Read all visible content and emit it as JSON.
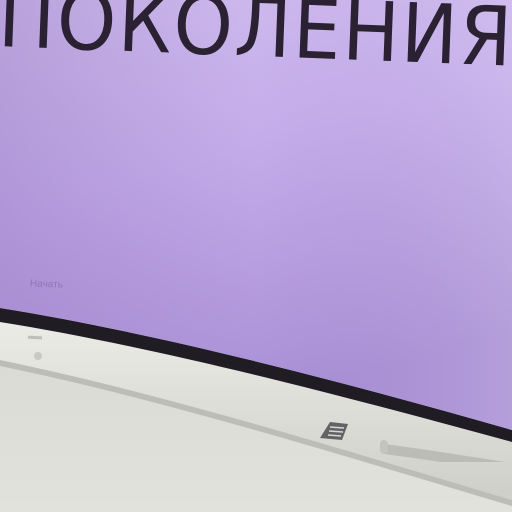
{
  "screen": {
    "headline": "ПОКОЛЕНИЯ",
    "small_label": "Начать"
  },
  "colors": {
    "screen_top": "#cbb6ea",
    "screen_bottom": "#a68bd0",
    "text": "#2a2133",
    "bezel": "#1e1b22",
    "frame": "#e2e2dc",
    "wall": "#d9dad5"
  },
  "icons": {
    "logo": "monitor-logo-icon",
    "speaker": "speaker-grille-icon",
    "led": "power-led-icon"
  }
}
